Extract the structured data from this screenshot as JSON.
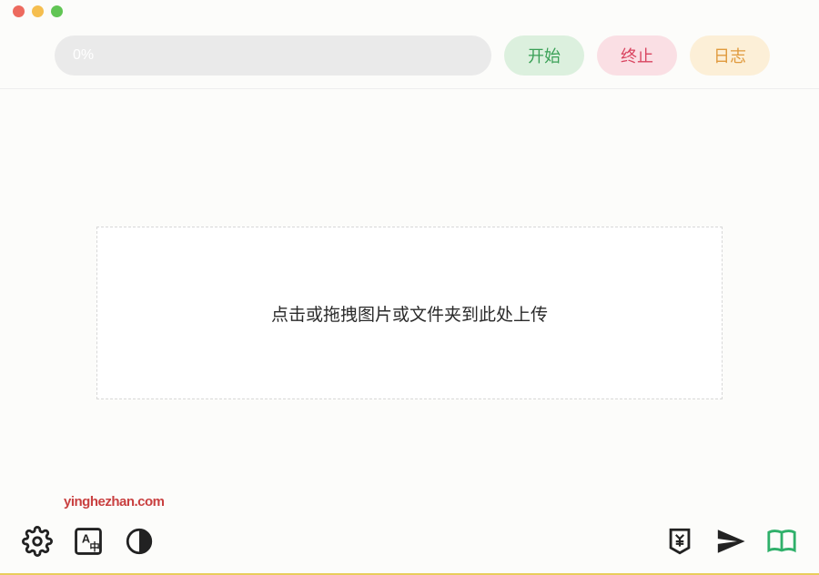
{
  "titlebar": {
    "traffic_lights": [
      "close",
      "minimize",
      "maximize"
    ]
  },
  "toolbar": {
    "progress_text": "0%",
    "start_label": "开始",
    "stop_label": "终止",
    "log_label": "日志"
  },
  "dropzone": {
    "text": "点击或拖拽图片或文件夹到此处上传"
  },
  "watermark": {
    "text": "yinghezhan.com"
  },
  "bottom_icons": {
    "left": [
      "settings",
      "translate",
      "contrast"
    ],
    "right": [
      "currency",
      "send",
      "book"
    ]
  }
}
